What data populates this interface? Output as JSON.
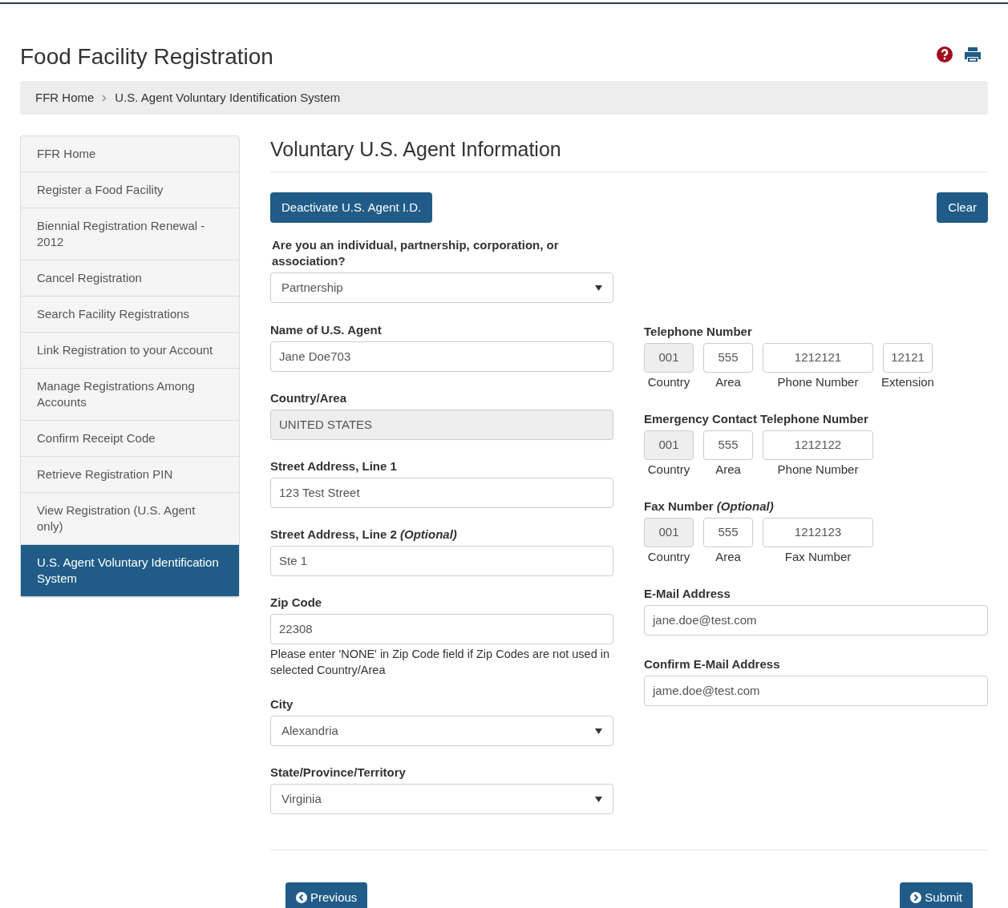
{
  "header": {
    "title": "Food Facility Registration"
  },
  "breadcrumb": [
    "FFR Home",
    "U.S. Agent Voluntary Identification System"
  ],
  "sidebar": {
    "items": [
      {
        "label": "FFR Home",
        "selected": false
      },
      {
        "label": "Register a Food Facility",
        "selected": false
      },
      {
        "label": "Biennial Registration Renewal - 2012",
        "selected": false
      },
      {
        "label": "Cancel Registration",
        "selected": false
      },
      {
        "label": "Search Facility Registrations",
        "selected": false
      },
      {
        "label": "Link Registration to your Account",
        "selected": false
      },
      {
        "label": "Manage Registrations Among Accounts",
        "selected": false
      },
      {
        "label": "Confirm Receipt Code",
        "selected": false
      },
      {
        "label": "Retrieve Registration PIN",
        "selected": false
      },
      {
        "label": "View Registration (U.S. Agent only)",
        "selected": false
      },
      {
        "label": "U.S. Agent Voluntary Identification System",
        "selected": true
      }
    ]
  },
  "main": {
    "heading": "Voluntary U.S. Agent Information",
    "deactivate_button": "Deactivate U.S. Agent I.D.",
    "clear_button": "Clear",
    "entity_type": {
      "label": "Are you an individual, partnership, corporation, or association?",
      "value": "Partnership"
    },
    "left_fields": [
      {
        "kind": "text",
        "label": "Name of U.S. Agent",
        "value": "Jane Doe703",
        "disabled": false
      },
      {
        "kind": "text",
        "label": "Country/Area",
        "value": "UNITED STATES",
        "disabled": true
      },
      {
        "kind": "text",
        "label": "Street Address, Line 1",
        "value": "123 Test Street",
        "disabled": false
      },
      {
        "kind": "text",
        "label": "Street Address, Line 2 *(Optional)*",
        "value": "Ste 1",
        "disabled": false
      },
      {
        "kind": "text",
        "label": "Zip Code",
        "value": "22308",
        "disabled": false,
        "help": "Please enter 'NONE' in Zip Code field if Zip Codes are not used in selected Country/Area"
      },
      {
        "kind": "select",
        "label": "City",
        "value": "Alexandria",
        "disabled": false
      },
      {
        "kind": "select",
        "label": "State/Province/Territory",
        "value": "Virginia",
        "disabled": false
      }
    ],
    "right_groups": [
      {
        "kind": "phone",
        "label": "Telephone Number",
        "parts": [
          {
            "kind": "country",
            "value": "001",
            "caption": "Country",
            "disabled": true
          },
          {
            "kind": "area",
            "value": "555",
            "caption": "Area",
            "disabled": false
          },
          {
            "kind": "number",
            "value": "1212121",
            "caption": "Phone Number",
            "disabled": false
          },
          {
            "kind": "extension",
            "value": "12121",
            "caption": "Extension",
            "disabled": false
          }
        ]
      },
      {
        "kind": "phone",
        "label": "Emergency Contact Telephone Number",
        "parts": [
          {
            "kind": "country",
            "value": "001",
            "caption": "Country",
            "disabled": true
          },
          {
            "kind": "area",
            "value": "555",
            "caption": "Area",
            "disabled": false
          },
          {
            "kind": "number",
            "value": "1212122",
            "caption": "Phone Number",
            "disabled": false
          }
        ]
      },
      {
        "kind": "phone",
        "label": "Fax Number *(Optional)*",
        "parts": [
          {
            "kind": "country",
            "value": "001",
            "caption": "Country",
            "disabled": true
          },
          {
            "kind": "area",
            "value": "555",
            "caption": "Area",
            "disabled": false
          },
          {
            "kind": "number",
            "value": "1212123",
            "caption": "Fax Number",
            "disabled": false
          }
        ]
      },
      {
        "kind": "text",
        "label": "E-Mail Address",
        "value": "jane.doe@test.com"
      },
      {
        "kind": "text",
        "label": "Confirm E-Mail Address",
        "value": "jame.doe@test.com"
      }
    ],
    "previous_button": "Previous",
    "submit_button": "Submit"
  }
}
